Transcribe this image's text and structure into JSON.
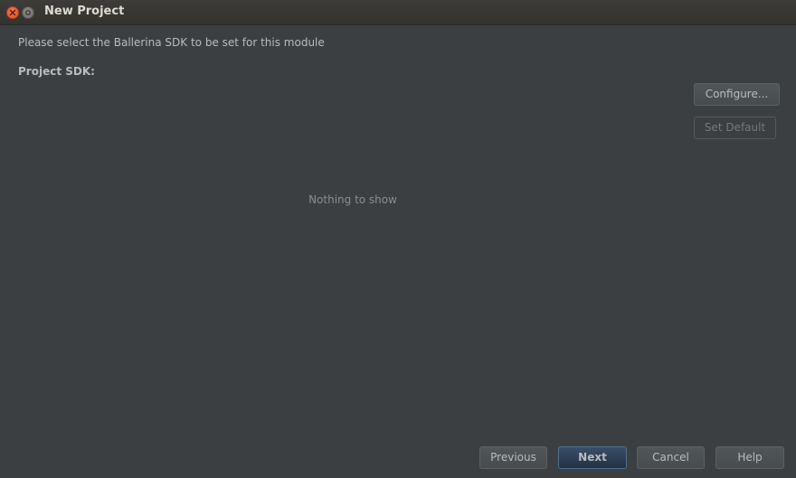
{
  "window": {
    "title": "New Project"
  },
  "content": {
    "instruction": "Please select the Ballerina SDK to be set for this module",
    "sdk_label": "Project SDK:",
    "empty_text": "Nothing to show"
  },
  "side_buttons": {
    "configure": "Configure...",
    "set_default": "Set Default"
  },
  "footer": {
    "previous": "Previous",
    "next": "Next",
    "cancel": "Cancel",
    "help": "Help"
  },
  "colors": {
    "background": "#3c3f41",
    "default_button": "#365880",
    "close_button": "#e95420"
  },
  "icons": {
    "close": "close-icon",
    "window_menu": "window-menu-icon"
  }
}
